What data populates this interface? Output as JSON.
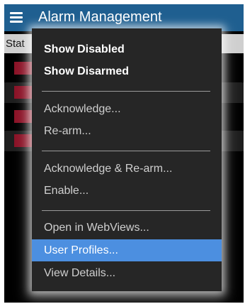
{
  "window": {
    "title": "Alarm Management",
    "header_bg": "#1f5f90"
  },
  "table": {
    "column_header": "Stat",
    "row_swatch_color": "#8b1226",
    "rows": 4
  },
  "context_menu": {
    "highlight_color": "#4c8fe0",
    "groups": [
      [
        {
          "label": "Show Disabled",
          "style": "bold"
        },
        {
          "label": "Show Disarmed",
          "style": "bold"
        }
      ],
      [
        {
          "label": "Acknowledge...",
          "style": "dim"
        },
        {
          "label": "Re-arm...",
          "style": "dim"
        }
      ],
      [
        {
          "label": "Acknowledge & Re-arm...",
          "style": "dim"
        },
        {
          "label": "Enable...",
          "style": "dim"
        }
      ],
      [
        {
          "label": "Open in WebViews...",
          "style": "dim"
        },
        {
          "label": "User Profiles...",
          "style": "highlighted"
        },
        {
          "label": "View Details...",
          "style": "dim"
        }
      ]
    ]
  }
}
